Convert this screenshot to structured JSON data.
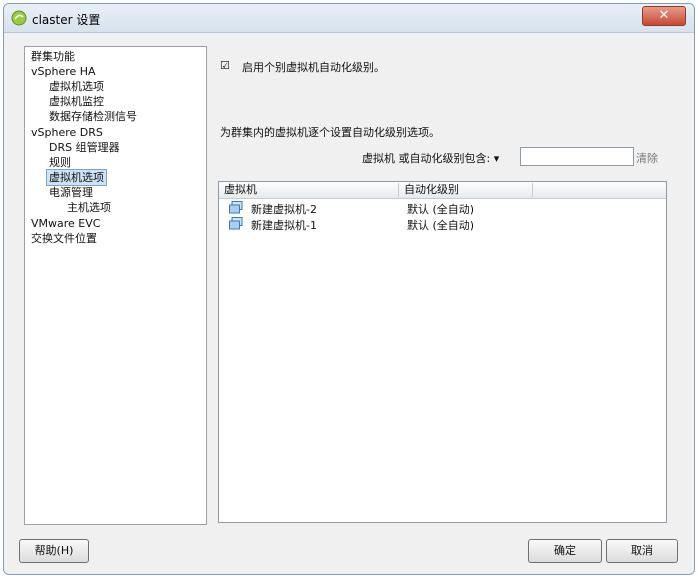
{
  "window": {
    "title": "claster 设置",
    "close_label": "✕"
  },
  "sidebar": {
    "items": [
      {
        "label": "群集功能"
      },
      {
        "label": "vSphere HA"
      },
      {
        "label": "虚拟机选项"
      },
      {
        "label": "虚拟机监控"
      },
      {
        "label": "数据存储检测信号"
      },
      {
        "label": "vSphere DRS"
      },
      {
        "label": "DRS 组管理器"
      },
      {
        "label": "规则"
      },
      {
        "label": "虚拟机选项",
        "selected": true
      },
      {
        "label": "电源管理"
      },
      {
        "label": "主机选项"
      },
      {
        "label": "VMware EVC"
      },
      {
        "label": "交换文件位置"
      }
    ]
  },
  "main": {
    "enable_checkbox": {
      "label": "启用个别虚拟机自动化级别。",
      "checked": true
    },
    "description": "为群集内的虚拟机逐个设置自动化级别选项。",
    "filter": {
      "label": "虚拟机 或自动化级别包含: ▾",
      "value": "",
      "clear_label": "清除"
    },
    "table": {
      "columns": [
        "虚拟机",
        "自动化级别"
      ],
      "rows": [
        {
          "vm": "新建虚拟机-2",
          "level": "默认 (全自动)"
        },
        {
          "vm": "新建虚拟机-1",
          "level": "默认 (全自动)"
        }
      ]
    }
  },
  "footer": {
    "help_label": "帮助(H)",
    "ok_label": "确定",
    "cancel_label": "取消"
  },
  "colors": {
    "selection": "#cde3f8",
    "close_button": "#c74a34",
    "border": "#7f9db9"
  }
}
